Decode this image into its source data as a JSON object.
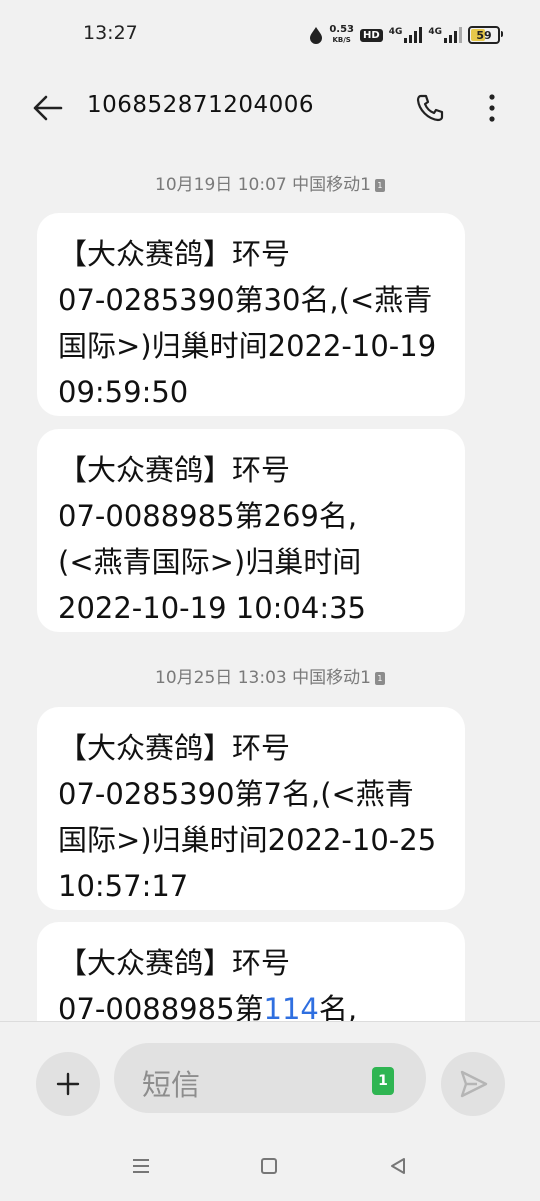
{
  "status_bar": {
    "time": "13:27",
    "speed_value": "0.53",
    "speed_unit": "KB/S",
    "hd_label": "HD",
    "sim1_network": "4G",
    "sim2_network": "4G",
    "battery": "59",
    "battery_color": "#e6c84a"
  },
  "header": {
    "title": "106852871204006"
  },
  "messages": {
    "ts1": {
      "text": "10月19日 10:07 中国移动1",
      "sim": "1"
    },
    "m1": "【大众赛鸽】环号\n07-0285390第30名,(<燕青\n国际>)归巢时间2022-10-19\n09:59:50",
    "m2": "【大众赛鸽】环号\n07-0088985第269名,\n(<燕青国际>)归巢时间\n2022-10-19 10:04:35",
    "ts2": {
      "text": "10月25日 13:03 中国移动1",
      "sim": "1"
    },
    "m3": "【大众赛鸽】环号\n07-0285390第7名,(<燕青\n国际>)归巢时间2022-10-25\n10:57:17",
    "m4": {
      "line1": "【大众赛鸽】环号",
      "prefix": "07-0088985第",
      "link": "114",
      "suffix": "名,"
    }
  },
  "composer": {
    "placeholder": "短信",
    "sim_badge": "1",
    "sim_color": "#2fb552"
  },
  "link_color": "#2f6fe0"
}
